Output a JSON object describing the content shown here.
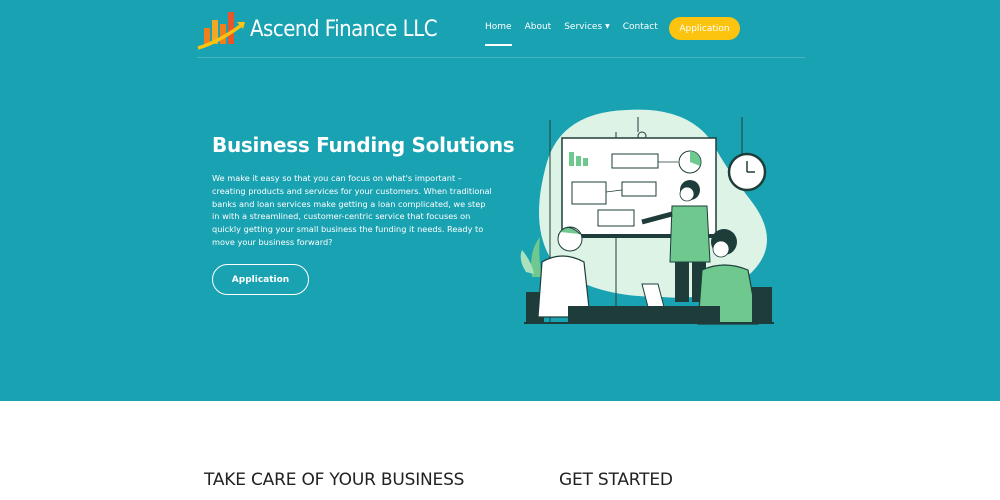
{
  "brand": {
    "name": "Ascend Finance LLC",
    "logo_icon": "bar-chart-arrow-logo",
    "colors": {
      "hero_bg": "#19a2b2",
      "accent": "#fcc30f",
      "logo_orange": "#f07f1c"
    }
  },
  "nav": {
    "items": [
      {
        "label": "Home",
        "active": true
      },
      {
        "label": "About",
        "active": false
      },
      {
        "label": "Services",
        "active": false,
        "has_dropdown": true
      },
      {
        "label": "Contact",
        "active": false
      }
    ],
    "cta_label": "Application"
  },
  "hero": {
    "title": "Business Funding Solutions",
    "text": "We make it easy so that you can focus on what's important – creating products and services for your customers. When traditional banks and loan services make getting a loan complicated, we step in with a streamlined, customer-centric service that focuses on quickly getting your small business the funding it needs. Ready to move your business forward?",
    "button_label": "Application"
  },
  "sections": {
    "left_title": "TAKE CARE OF YOUR BUSINESS",
    "right_title": "GET STARTED"
  }
}
